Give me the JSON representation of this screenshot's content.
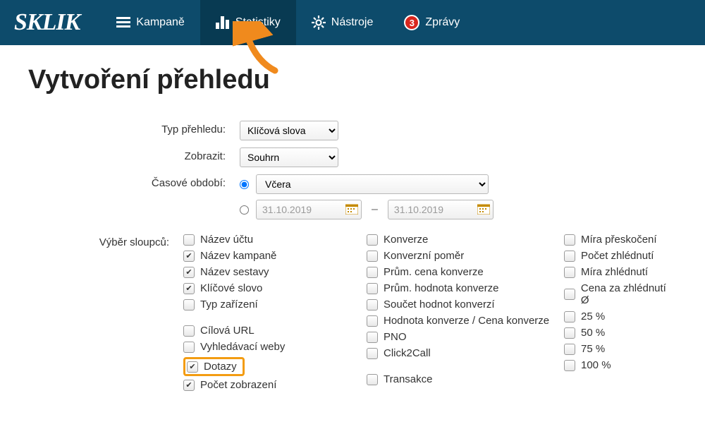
{
  "nav": {
    "logo": "SKLIK",
    "items": [
      {
        "label": "Kampaně"
      },
      {
        "label": "Statistiky"
      },
      {
        "label": "Nástroje"
      },
      {
        "label": "Zprávy",
        "badge": "3"
      }
    ]
  },
  "page": {
    "title": "Vytvoření přehledu"
  },
  "form": {
    "type_label": "Typ přehledu:",
    "type_value": "Klíčová slova",
    "show_label": "Zobrazit:",
    "show_value": "Souhrn",
    "period_label": "Časové období:",
    "period_preset": "Včera",
    "date_from": "31.10.2019",
    "date_to": "31.10.2019",
    "columns_label": "Výběr sloupců:"
  },
  "columns": {
    "left": [
      {
        "label": "Název účtu",
        "checked": false
      },
      {
        "label": "Název kampaně",
        "checked": true
      },
      {
        "label": "Název sestavy",
        "checked": true
      },
      {
        "label": "Klíčové slovo",
        "checked": true
      },
      {
        "label": "Typ zařízení",
        "checked": false
      },
      {
        "_spacer": true
      },
      {
        "label": "Cílová URL",
        "checked": false
      },
      {
        "label": "Vyhledávací weby",
        "checked": false
      },
      {
        "label": "Dotazy",
        "checked": true,
        "highlight": true
      },
      {
        "label": "Počet zobrazení",
        "checked": true
      }
    ],
    "mid": [
      {
        "label": "Konverze",
        "checked": false
      },
      {
        "label": "Konverzní poměr",
        "checked": false
      },
      {
        "label": "Prům. cena konverze",
        "checked": false
      },
      {
        "label": "Prům. hodnota konverze",
        "checked": false
      },
      {
        "label": "Součet hodnot konverzí",
        "checked": false
      },
      {
        "label": "Hodnota konverze / Cena konverze",
        "checked": false
      },
      {
        "label": "PNO",
        "checked": false
      },
      {
        "label": "Click2Call",
        "checked": false
      },
      {
        "_spacer": true
      },
      {
        "label": "Transakce",
        "checked": false
      }
    ],
    "right": [
      {
        "label": "Míra přeskočení",
        "checked": false
      },
      {
        "label": "Počet zhlédnutí",
        "checked": false
      },
      {
        "label": "Míra zhlédnutí",
        "checked": false
      },
      {
        "label": "Cena za zhlédnutí Ø",
        "checked": false
      },
      {
        "label": "25 %",
        "checked": false
      },
      {
        "label": "50 %",
        "checked": false
      },
      {
        "label": "75 %",
        "checked": false
      },
      {
        "label": "100 %",
        "checked": false
      }
    ]
  }
}
